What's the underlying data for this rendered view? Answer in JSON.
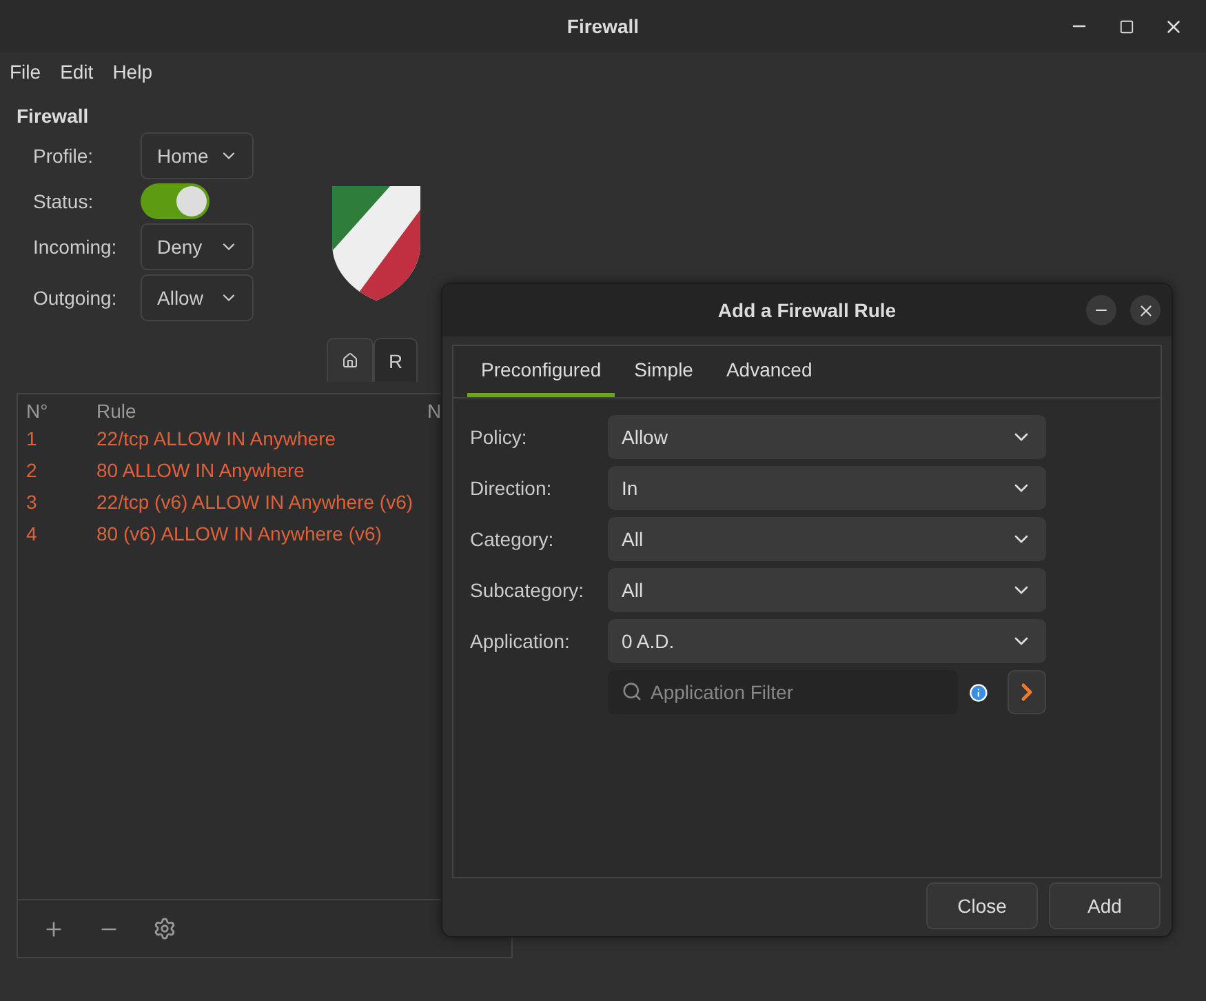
{
  "window": {
    "title": "Firewall"
  },
  "menu": [
    "File",
    "Edit",
    "Help"
  ],
  "firewall": {
    "heading": "Firewall",
    "settings": [
      {
        "kind": "select",
        "label": "Profile:",
        "value": "Home"
      },
      {
        "kind": "switch",
        "label": "Status:",
        "on": true
      },
      {
        "kind": "select",
        "label": "Incoming:",
        "value": "Deny"
      },
      {
        "kind": "select",
        "label": "Outgoing:",
        "value": "Allow"
      }
    ]
  },
  "tabs": [
    {
      "kind": "icon",
      "selected": true
    },
    {
      "kind": "text",
      "label": "R",
      "selected": false
    }
  ],
  "rules": {
    "columns": [
      "N°",
      "Rule",
      "N"
    ],
    "rows": [
      {
        "cells": [
          "1",
          "22/tcp ALLOW IN Anywhere"
        ]
      },
      {
        "cells": [
          "2",
          "80 ALLOW IN Anywhere"
        ]
      },
      {
        "cells": [
          "3",
          "22/tcp (v6) ALLOW IN Anywhere (v6)"
        ]
      },
      {
        "cells": [
          "4",
          "80 (v6) ALLOW IN Anywhere (v6)"
        ]
      }
    ]
  },
  "dialog": {
    "title": "Add a Firewall Rule",
    "tabs": [
      {
        "label": "Preconfigured",
        "selected": true
      },
      {
        "label": "Simple",
        "selected": false
      },
      {
        "label": "Advanced",
        "selected": false
      }
    ],
    "fields": [
      {
        "label": "Policy:",
        "value": "Allow"
      },
      {
        "label": "Direction:",
        "value": "In"
      },
      {
        "label": "Category:",
        "value": "All"
      },
      {
        "label": "Subcategory:",
        "value": "All"
      },
      {
        "label": "Application:",
        "value": "0 A.D."
      }
    ],
    "filter": {
      "placeholder": "Application Filter"
    },
    "buttons": [
      "Close",
      "Add"
    ]
  }
}
